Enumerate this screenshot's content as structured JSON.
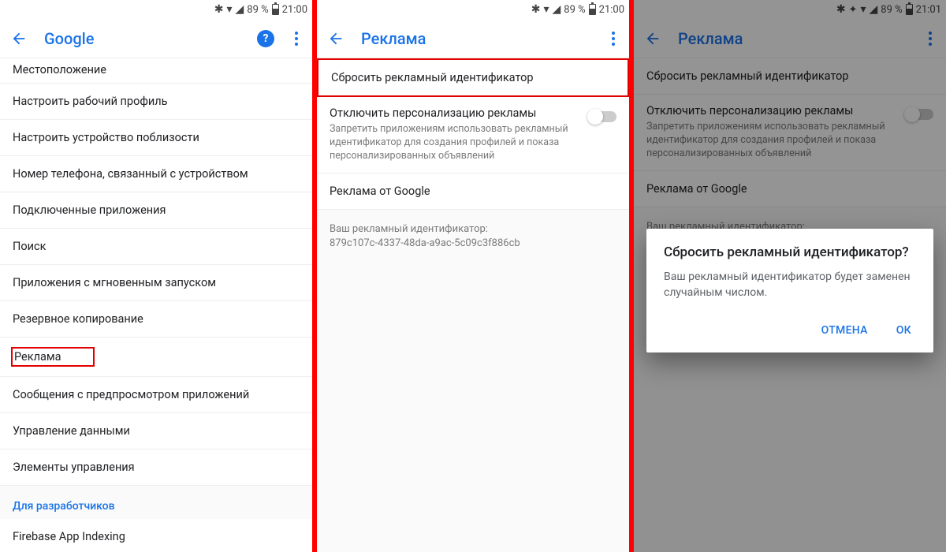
{
  "status": {
    "battery_pct": "89 %",
    "time_a": "21:00",
    "time_c": "21:01"
  },
  "panel1": {
    "title": "Google",
    "items": [
      "Местоположение",
      "Настроить рабочий профиль",
      "Настроить устройство поблизости",
      "Номер телефона, связанный с устройством",
      "Подключенные приложения",
      "Поиск",
      "Приложения с мгновенным запуском",
      "Резервное копирование",
      "Реклама",
      "Сообщения с предпросмотром приложений",
      "Управление данными",
      "Элементы управления"
    ],
    "dev_category": "Для разработчиков",
    "dev_item": "Firebase App Indexing"
  },
  "panel2": {
    "title": "Реклама",
    "reset_label": "Сбросить рекламный идентификатор",
    "optout_title": "Отключить персонализацию рекламы",
    "optout_sub": "Запретить приложениям использовать рекламный идентификатор для создания профилей и показа персонализированных объявлений",
    "ads_by": "Реклама от Google",
    "id_label": "Ваш рекламный идентификатор:",
    "id_value": "879c107c-4337-48da-a9ac-5c09c3f886cb"
  },
  "dialog": {
    "title": "Сбросить рекламный идентификатор?",
    "body": "Ваш рекламный идентификатор будет заменен случайным числом.",
    "cancel": "ОТМЕНА",
    "ok": "ОК"
  }
}
